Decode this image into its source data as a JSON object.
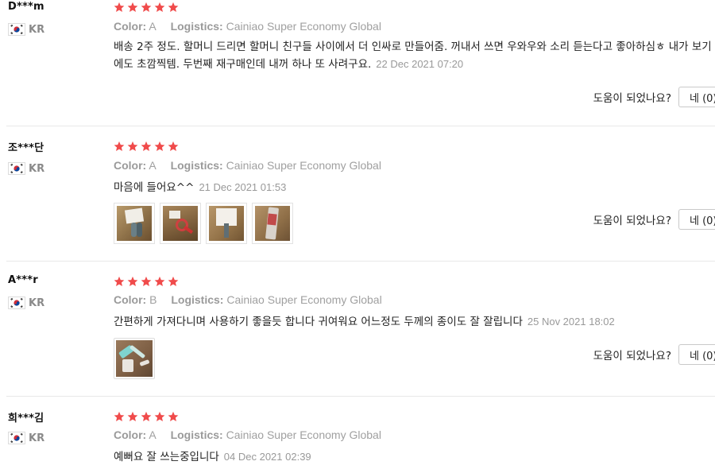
{
  "colors": {
    "star": "#f04b4b",
    "divider": "#e8e8e8",
    "meta": "#9a9a9a",
    "date": "#999999"
  },
  "helpful": {
    "label": "도움이 되었나요?",
    "yes_label": "네 (0)"
  },
  "meta_labels": {
    "color": "Color:",
    "logistics": "Logistics:"
  },
  "reviews": [
    {
      "user": "D***m",
      "country": "KR",
      "flag_icon": "korea-flag-icon",
      "rating": 5,
      "color": "A",
      "logistics": "Cainiao Super Economy Global",
      "text": "배송 2주 정도. 할머니 드리면 할머니 친구들 사이에서 더 인싸로 만들어줌. 꺼내서 쓰면 우와우와 소리 듣는다고 좋아하심ㅎ 내가 보기에도 초깜찍템. 두번째 재구매인데 내꺼 하나 또 사려구요.",
      "date": "22 Dec 2021 07:20",
      "photos": []
    },
    {
      "user": "조***단",
      "country": "KR",
      "flag_icon": "korea-flag-icon",
      "rating": 5,
      "color": "A",
      "logistics": "Cainiao Super Economy Global",
      "text": "마음에 들어요^^",
      "date": "21 Dec 2021 01:53",
      "photos": [
        "review-photo-1",
        "review-photo-2",
        "review-photo-3",
        "review-photo-4"
      ]
    },
    {
      "user": "A***r",
      "country": "KR",
      "flag_icon": "korea-flag-icon",
      "rating": 5,
      "color": "B",
      "logistics": "Cainiao Super Economy Global",
      "text": "간편하게 가져다니며 사용하기 좋을듯 합니다 귀여워요 어느정도 두께의 종이도 잘 잘립니다",
      "date": "25 Nov 2021 18:02",
      "photos": [
        "review-photo-1"
      ]
    },
    {
      "user": "희***김",
      "country": "KR",
      "flag_icon": "korea-flag-icon",
      "rating": 5,
      "color": "A",
      "logistics": "Cainiao Super Economy Global",
      "text": "예뻐요 잘 쓰는중입니다",
      "date": "04 Dec 2021 02:39",
      "photos": []
    }
  ]
}
